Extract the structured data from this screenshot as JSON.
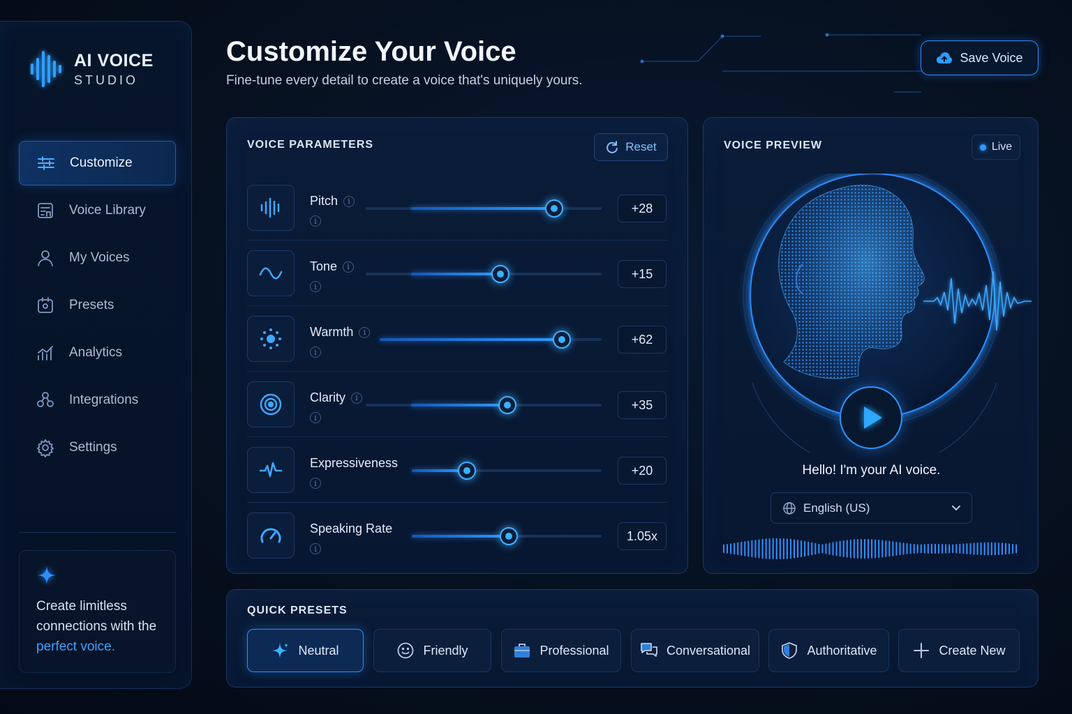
{
  "brand": {
    "title": "AI VOICE",
    "subtitle": "STUDIO"
  },
  "sidebar": {
    "items": [
      {
        "label": "Customize",
        "icon": "sliders-icon",
        "active": true
      },
      {
        "label": "Voice Library",
        "icon": "library-icon",
        "active": false
      },
      {
        "label": "My Voices",
        "icon": "user-icon",
        "active": false
      },
      {
        "label": "Presets",
        "icon": "presets-icon",
        "active": false
      },
      {
        "label": "Analytics",
        "icon": "analytics-icon",
        "active": false
      },
      {
        "label": "Integrations",
        "icon": "integrations-icon",
        "active": false
      },
      {
        "label": "Settings",
        "icon": "gear-icon",
        "active": false
      }
    ],
    "promo": {
      "text": "Create limitless connections with the ",
      "accent": "perfect voice."
    }
  },
  "header": {
    "title": "Customize Your Voice",
    "subtitle": "Fine-tune every detail to create a voice that's uniquely yours.",
    "save_label": "Save Voice"
  },
  "params": {
    "title": "VOICE PARAMETERS",
    "reset_label": "Reset",
    "items": [
      {
        "label": "Pitch",
        "value": "+28",
        "level": 0.8,
        "icon": "waveform-icon"
      },
      {
        "label": "Tone",
        "value": "+15",
        "level": 0.57,
        "icon": "sine-wave-icon"
      },
      {
        "label": "Warmth",
        "value": "+62",
        "level": 0.82,
        "icon": "sun-icon"
      },
      {
        "label": "Clarity",
        "value": "+35",
        "level": 0.6,
        "icon": "target-icon"
      },
      {
        "label": "Expressiveness",
        "value": "+20",
        "level": 0.29,
        "icon": "heartbeat-icon"
      },
      {
        "label": "Speaking Rate",
        "value": "1.05x",
        "level": 0.51,
        "icon": "speedometer-icon"
      }
    ]
  },
  "preview": {
    "title": "VOICE PREVIEW",
    "live_label": "Live",
    "greeting": "Hello! I'm your AI voice.",
    "language": "English (US)"
  },
  "presets": {
    "title": "QUICK PRESETS",
    "items": [
      {
        "label": "Neutral",
        "icon": "sparkle-icon",
        "active": true
      },
      {
        "label": "Friendly",
        "icon": "smile-icon",
        "active": false
      },
      {
        "label": "Professional",
        "icon": "briefcase-icon",
        "active": false
      },
      {
        "label": "Conversational",
        "icon": "chat-icon",
        "active": false
      },
      {
        "label": "Authoritative",
        "icon": "shield-icon",
        "active": false
      },
      {
        "label": "Create New",
        "icon": "plus-icon",
        "active": false
      }
    ]
  },
  "colors": {
    "accent": "#2e9bff",
    "background": "#06101f",
    "panel": "#0a1c38"
  }
}
